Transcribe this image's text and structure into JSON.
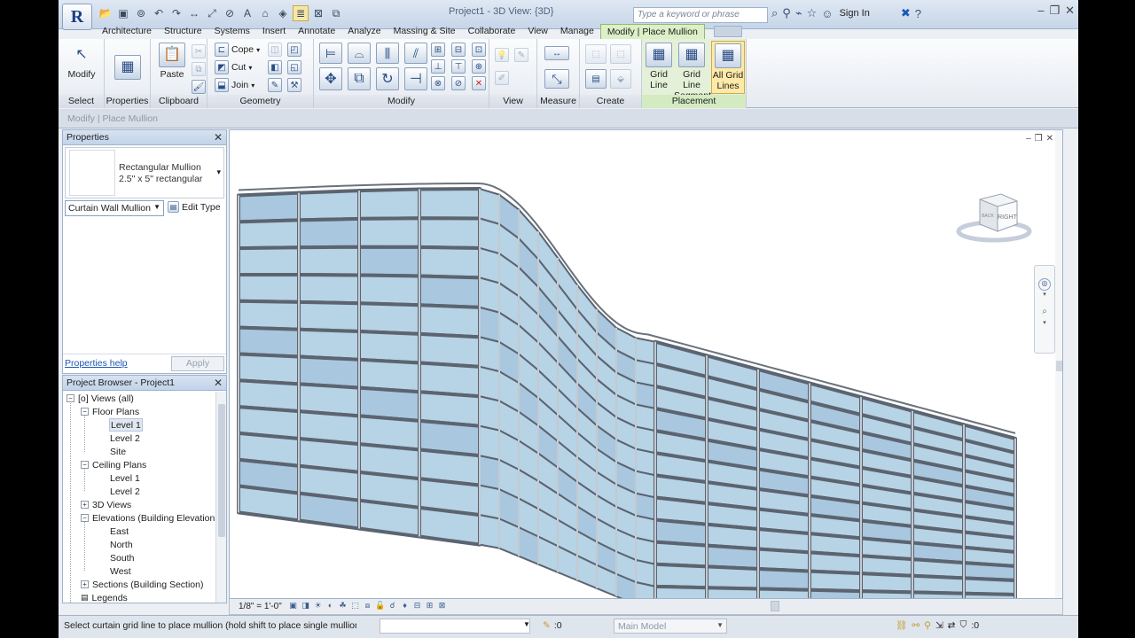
{
  "titlebar": {
    "title": "Project1 - 3D View: {3D}",
    "search_placeholder": "Type a keyword or phrase",
    "sign_in": "Sign In",
    "logo": "R"
  },
  "tabs": [
    {
      "label": "Architecture"
    },
    {
      "label": "Structure"
    },
    {
      "label": "Systems"
    },
    {
      "label": "Insert"
    },
    {
      "label": "Annotate"
    },
    {
      "label": "Analyze"
    },
    {
      "label": "Massing & Site"
    },
    {
      "label": "Collaborate"
    },
    {
      "label": "View"
    },
    {
      "label": "Manage"
    },
    {
      "label": "Modify | Place Mullion"
    }
  ],
  "ribbon": {
    "select": {
      "modify_label": "Modify",
      "panel_label": "Select"
    },
    "properties": {
      "label": "Properties",
      "panel_label": "Properties"
    },
    "clipboard": {
      "paste_label": "Paste",
      "panel_label": "Clipboard"
    },
    "geometry": {
      "cope_label": "Cope",
      "cut_label": "Cut",
      "join_label": "Join",
      "panel_label": "Geometry"
    },
    "modify": {
      "panel_label": "Modify"
    },
    "view": {
      "panel_label": "View"
    },
    "measure": {
      "panel_label": "Measure"
    },
    "create": {
      "panel_label": "Create"
    },
    "placement": {
      "panel_label": "Placement",
      "grid_line_1": "Grid",
      "grid_line_2": "Line",
      "segment_1": "Grid Line",
      "segment_2": "Segment",
      "all_1": "All Grid",
      "all_2": "Lines"
    }
  },
  "optbar": {
    "label": "Modify | Place Mullion"
  },
  "properties_palette": {
    "title": "Properties",
    "type_line1": "Rectangular Mullion",
    "type_line2": "2.5\" x 5\" rectangular",
    "instance_filter": "Curtain Wall Mullion",
    "edit_type": "Edit Type",
    "help": "Properties help",
    "apply": "Apply"
  },
  "project_browser": {
    "title": "Project Browser - Project1",
    "nodes": {
      "views": "Views (all)",
      "floor_plans": "Floor Plans",
      "fp_level1": "Level 1",
      "fp_level2": "Level 2",
      "fp_site": "Site",
      "ceiling_plans": "Ceiling Plans",
      "cp_level1": "Level 1",
      "cp_level2": "Level 2",
      "views3d": "3D Views",
      "elevations": "Elevations (Building Elevation",
      "east": "East",
      "north": "North",
      "south": "South",
      "west": "West",
      "sections": "Sections (Building Section)",
      "legends": "Legends"
    }
  },
  "viewcube": {
    "face": "RIGHT",
    "corner": "BACK"
  },
  "view_control": {
    "scale": "1/8\" = 1'-0\""
  },
  "statusbar": {
    "message": "Select curtain grid line to place mullion (hold shift to place single mullion, c",
    "count": ":0",
    "model": "Main Model",
    "filter_count": ":0"
  },
  "colors": {
    "accent": "#1b3f86",
    "context_tab": "#dcefc7",
    "glass": "#b7d3e6"
  }
}
